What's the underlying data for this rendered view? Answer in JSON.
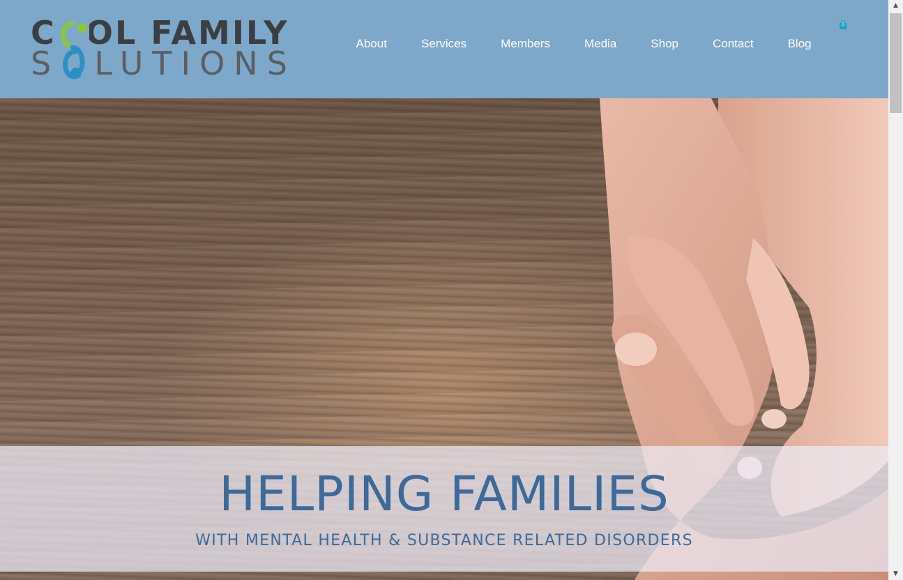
{
  "logo": {
    "line1": "COOL FAMILY",
    "line2": "SOLUTIONS"
  },
  "nav": {
    "items": [
      {
        "label": "About"
      },
      {
        "label": "Services"
      },
      {
        "label": "Members"
      },
      {
        "label": "Media"
      },
      {
        "label": "Shop"
      },
      {
        "label": "Contact"
      },
      {
        "label": "Blog"
      }
    ]
  },
  "cart": {
    "count": "0",
    "icon": "shopping-bag-icon"
  },
  "hero": {
    "title": "HELPING FAMILIES",
    "subtitle": "WITH MENTAL HEALTH & SUBSTANCE RELATED DISORDERS"
  },
  "scrollbar": {
    "up_glyph": "▲",
    "down_glyph": "▼"
  },
  "colors": {
    "header_bg": "#7ea8c9",
    "accent_blue": "#3c6a99",
    "logo_green": "#8cc63f",
    "logo_blue": "#2d8fc4"
  }
}
